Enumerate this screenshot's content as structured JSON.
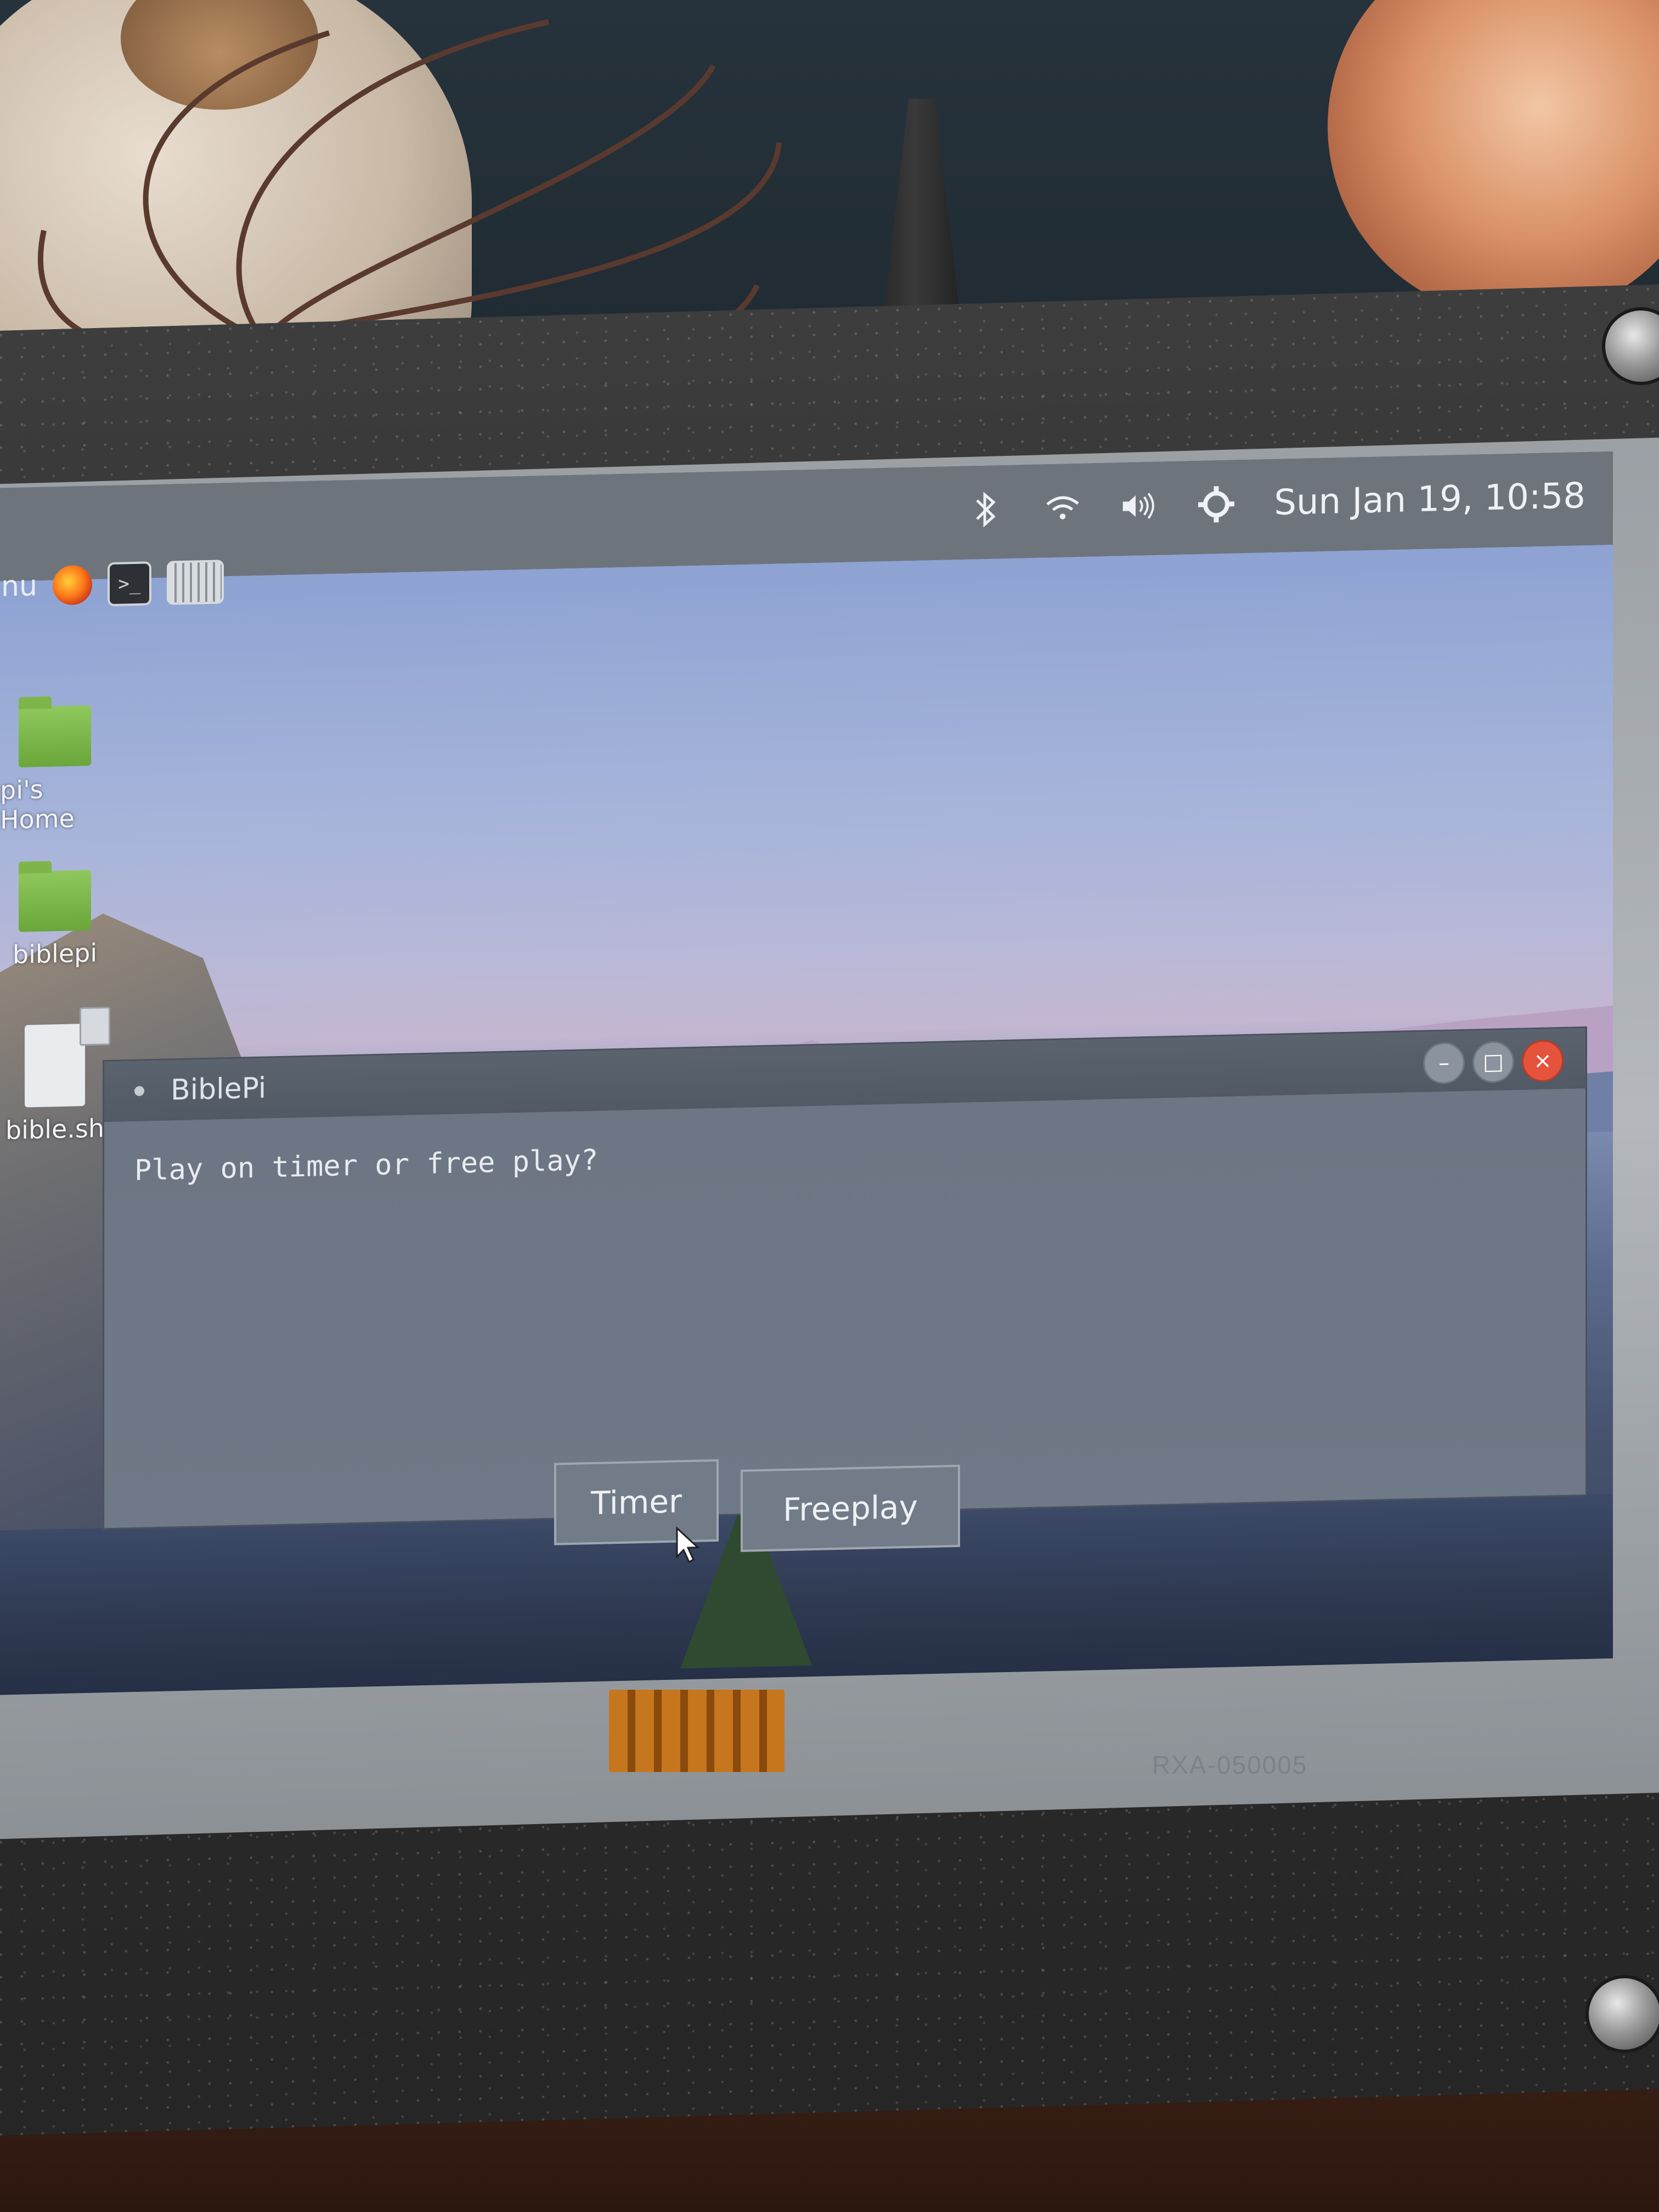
{
  "top_panel": {
    "clock": "Sun Jan 19, 10:58",
    "icons": [
      "bluetooth-icon",
      "wifi-icon",
      "volume-icon",
      "settings-gear-icon"
    ]
  },
  "launcher": {
    "menu_label": "enu",
    "icons": [
      "firefox-icon",
      "terminal-icon",
      "keyboard-icon"
    ]
  },
  "desktop": {
    "icons": [
      {
        "label": "pi's Home",
        "icon": "home-folder-icon"
      },
      {
        "label": "biblepi",
        "icon": "folder-icon"
      },
      {
        "label": "bible.sh",
        "icon": "script-file-icon"
      }
    ]
  },
  "dialog": {
    "title": "BiblePi",
    "message": "Play on timer or free play?",
    "buttons": {
      "timer": "Timer",
      "freeplay": "Freeplay"
    },
    "controls": {
      "minimize": "–",
      "maximize": "□",
      "close": "×"
    }
  },
  "hardware": {
    "panel_label": "RXA-050005"
  },
  "colors": {
    "close_button": "#e6533c",
    "folder_green": "#7db54b",
    "panel_gray": "#6d747c"
  }
}
